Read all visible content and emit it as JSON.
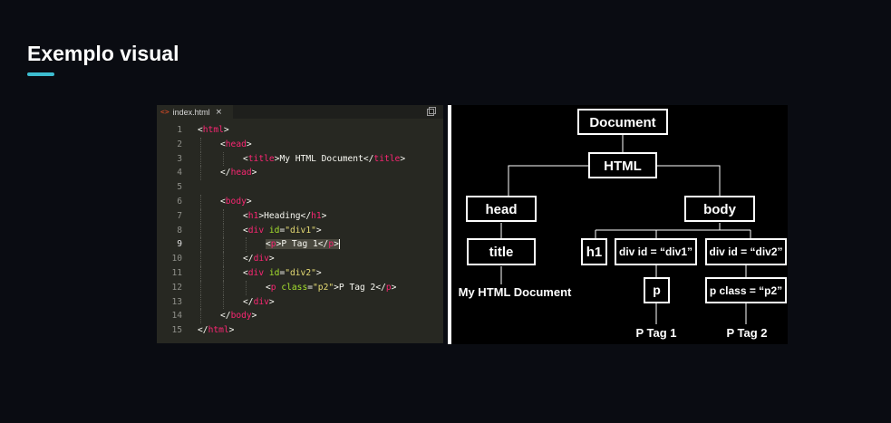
{
  "slide": {
    "title": "Exemplo visual",
    "accent_color": "#3dbdd0"
  },
  "editor": {
    "tab": {
      "icon": "html-file-icon",
      "filename": "index.html",
      "close_glyph": "×"
    },
    "split_icon": "split-editor-icon",
    "active_line": 9,
    "lines": [
      {
        "n": "1",
        "indent": 0,
        "tokens": [
          {
            "c": "w",
            "t": "<"
          },
          {
            "c": "t",
            "t": "html"
          },
          {
            "c": "w",
            "t": ">"
          }
        ]
      },
      {
        "n": "2",
        "indent": 1,
        "tokens": [
          {
            "c": "w",
            "t": "<"
          },
          {
            "c": "t",
            "t": "head"
          },
          {
            "c": "w",
            "t": ">"
          }
        ]
      },
      {
        "n": "3",
        "indent": 2,
        "tokens": [
          {
            "c": "w",
            "t": "<"
          },
          {
            "c": "t",
            "t": "title"
          },
          {
            "c": "w",
            "t": ">My HTML Document</"
          },
          {
            "c": "t",
            "t": "title"
          },
          {
            "c": "w",
            "t": ">"
          }
        ]
      },
      {
        "n": "4",
        "indent": 1,
        "tokens": [
          {
            "c": "w",
            "t": "</"
          },
          {
            "c": "t",
            "t": "head"
          },
          {
            "c": "w",
            "t": ">"
          }
        ]
      },
      {
        "n": "5",
        "indent": 0,
        "tokens": []
      },
      {
        "n": "6",
        "indent": 1,
        "tokens": [
          {
            "c": "w",
            "t": "<"
          },
          {
            "c": "t",
            "t": "body"
          },
          {
            "c": "w",
            "t": ">"
          }
        ]
      },
      {
        "n": "7",
        "indent": 2,
        "tokens": [
          {
            "c": "w",
            "t": "<"
          },
          {
            "c": "t",
            "t": "h1"
          },
          {
            "c": "w",
            "t": ">Heading</"
          },
          {
            "c": "t",
            "t": "h1"
          },
          {
            "c": "w",
            "t": ">"
          }
        ]
      },
      {
        "n": "8",
        "indent": 2,
        "tokens": [
          {
            "c": "w",
            "t": "<"
          },
          {
            "c": "t",
            "t": "div"
          },
          {
            "c": "w",
            "t": " "
          },
          {
            "c": "a",
            "t": "id"
          },
          {
            "c": "w",
            "t": "="
          },
          {
            "c": "s",
            "t": "\"div1\""
          },
          {
            "c": "w",
            "t": ">"
          }
        ]
      },
      {
        "n": "9",
        "indent": 3,
        "tokens": [
          {
            "c": "w hl",
            "t": "<"
          },
          {
            "c": "t hl",
            "t": "p"
          },
          {
            "c": "w hl",
            "t": ">P Tag 1</"
          },
          {
            "c": "t hl",
            "t": "p"
          },
          {
            "c": "w hl",
            "t": ">"
          }
        ]
      },
      {
        "n": "10",
        "indent": 2,
        "tokens": [
          {
            "c": "w",
            "t": "</"
          },
          {
            "c": "t",
            "t": "div"
          },
          {
            "c": "w",
            "t": ">"
          }
        ]
      },
      {
        "n": "11",
        "indent": 2,
        "tokens": [
          {
            "c": "w",
            "t": "<"
          },
          {
            "c": "t",
            "t": "div"
          },
          {
            "c": "w",
            "t": " "
          },
          {
            "c": "a",
            "t": "id"
          },
          {
            "c": "w",
            "t": "="
          },
          {
            "c": "s",
            "t": "\"div2\""
          },
          {
            "c": "w",
            "t": ">"
          }
        ]
      },
      {
        "n": "12",
        "indent": 3,
        "tokens": [
          {
            "c": "w",
            "t": "<"
          },
          {
            "c": "t",
            "t": "p"
          },
          {
            "c": "w",
            "t": " "
          },
          {
            "c": "a",
            "t": "class"
          },
          {
            "c": "w",
            "t": "="
          },
          {
            "c": "s",
            "t": "\"p2\""
          },
          {
            "c": "w",
            "t": ">P Tag 2</"
          },
          {
            "c": "t",
            "t": "p"
          },
          {
            "c": "w",
            "t": ">"
          }
        ]
      },
      {
        "n": "13",
        "indent": 2,
        "tokens": [
          {
            "c": "w",
            "t": "</"
          },
          {
            "c": "t",
            "t": "div"
          },
          {
            "c": "w",
            "t": ">"
          }
        ]
      },
      {
        "n": "14",
        "indent": 1,
        "tokens": [
          {
            "c": "w",
            "t": "</"
          },
          {
            "c": "t",
            "t": "body"
          },
          {
            "c": "w",
            "t": ">"
          }
        ]
      },
      {
        "n": "15",
        "indent": 0,
        "tokens": [
          {
            "c": "w",
            "t": "</"
          },
          {
            "c": "t",
            "t": "html"
          },
          {
            "c": "w",
            "t": ">"
          }
        ]
      }
    ]
  },
  "tree": {
    "nodes": {
      "document": "Document",
      "html": "HTML",
      "head": "head",
      "body": "body",
      "title": "title",
      "h1": "h1",
      "div1": "div id = “div1”",
      "div2": "div id = “div2”",
      "p1": "p",
      "p2": "p class = “p2”"
    },
    "texts": {
      "title_text": "My HTML Document",
      "p1_text": "P Tag 1",
      "p2_text": "P Tag 2"
    }
  }
}
